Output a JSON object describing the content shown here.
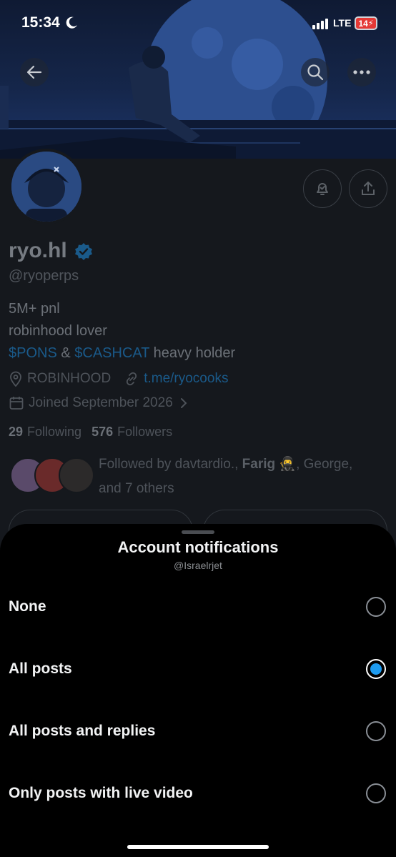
{
  "status_bar": {
    "time": "15:34",
    "network": "LTE",
    "battery": "14",
    "icons": [
      "moon-icon",
      "signal-icon",
      "battery-charging-icon"
    ]
  },
  "nav": {
    "icons": [
      "back-arrow-icon",
      "search-icon",
      "more-icon"
    ]
  },
  "profile": {
    "name": "ryo.hl",
    "handle": "@ryoperps",
    "bio_line1": "5M+ pnl",
    "bio_line2": "robinhood lover",
    "bio_cashtag1": "$PONS",
    "bio_amp": " & ",
    "bio_cashtag2": "$CASHCAT",
    "bio_tail": " heavy holder",
    "location": "ROBINHOOD",
    "website": "t.me/ryocooks",
    "joined": "Joined September 2026",
    "following_count": "29",
    "following_label": "Following",
    "followers_count": "576",
    "followers_label": "Followers",
    "followed_by_prefix": "Followed by davtardio., ",
    "followed_by_bold": "Farig",
    "followed_by_emoji": "🥷",
    "followed_by_suffix": ", George,",
    "followed_by_line2": "and 7 others"
  },
  "sheet": {
    "title": "Account notifications",
    "subtitle": "@Israelrjet",
    "options": [
      {
        "label": "None",
        "selected": false
      },
      {
        "label": "All posts",
        "selected": true
      },
      {
        "label": "All posts and replies",
        "selected": false
      },
      {
        "label": "Only posts with live video",
        "selected": false
      }
    ]
  },
  "colors": {
    "accent": "#1d9bf0",
    "sheet_background": "#000000",
    "dimmed_background": "#15181d"
  }
}
